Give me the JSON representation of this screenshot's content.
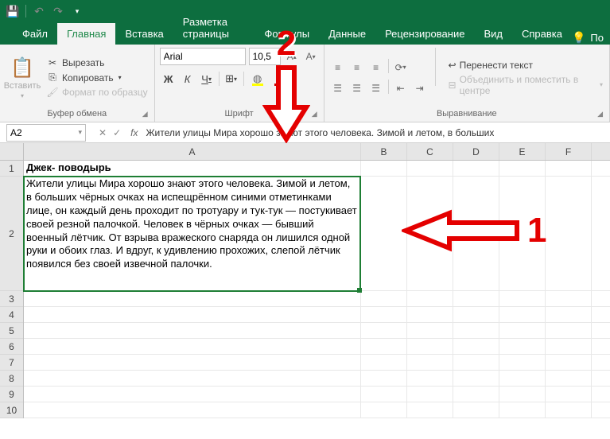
{
  "qat": {
    "save_tooltip": "Сохранить",
    "undo_tooltip": "Отменить",
    "redo_tooltip": "Вернуть"
  },
  "tabs": {
    "file": "Файл",
    "home": "Главная",
    "insert": "Вставка",
    "pagelayout": "Разметка страницы",
    "formulas": "Формулы",
    "data": "Данные",
    "review": "Рецензирование",
    "view": "Вид",
    "help": "Справка",
    "tellme": "По"
  },
  "ribbon": {
    "paste": "Вставить",
    "cut": "Вырезать",
    "copy": "Копировать",
    "formatpainter": "Формат по образцу",
    "clipboard_label": "Буфер обмена",
    "font_name": "Arial",
    "font_size": "10,5",
    "font_label": "Шрифт",
    "bold": "Ж",
    "italic": "К",
    "underline": "Ч",
    "wrap": "Перенести текст",
    "merge": "Объединить и поместить в центре",
    "alignment_label": "Выравнивание"
  },
  "addressbar": {
    "cellref": "A2",
    "formula": "Жители улицы Мира хорошо знают этого человека. Зимой и летом, в больших"
  },
  "columns": [
    "A",
    "B",
    "C",
    "D",
    "E",
    "F"
  ],
  "rows_visible": [
    1,
    2,
    3,
    4,
    5,
    6,
    7,
    8,
    9,
    10
  ],
  "cell_A1": "Джек- поводырь",
  "cell_A2": "Жители улицы Мира хорошо знают этого человека. Зимой и летом, в больших чёрных очках на испещрённом синими отметинками лице, он каждый день проходит по тротуару и тук-тук — постукивает своей резной палочкой. Человек в чёрных очках — бывший военный лётчик. От взрыва вражеского снаряда он лишился одной руки и обоих глаз. И вдруг, к удивлению прохожих, слепой лётчик появился без своей извечной палочки.",
  "annotations": {
    "num1": "1",
    "num2": "2"
  }
}
